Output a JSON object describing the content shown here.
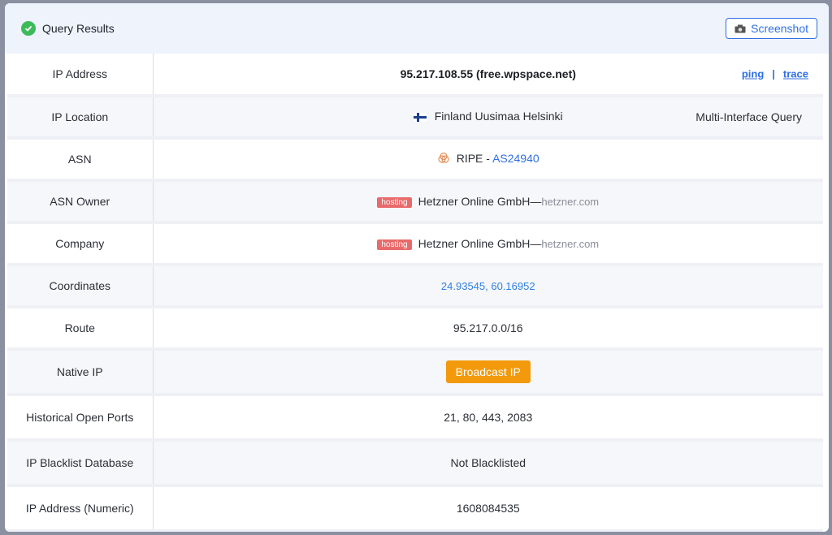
{
  "header": {
    "title": "Query Results",
    "screenshot_label": "Screenshot"
  },
  "rows": {
    "ip_address": {
      "label": "IP Address",
      "value": "95.217.108.55 (free.wpspace.net)",
      "ping": "ping",
      "separator": "|",
      "trace": "trace"
    },
    "ip_location": {
      "label": "IP Location",
      "value": "Finland Uusimaa Helsinki",
      "right": "Multi-Interface Query"
    },
    "asn": {
      "label": "ASN",
      "registry": "RIPE -",
      "asn_link": "AS24940"
    },
    "asn_owner": {
      "label": "ASN Owner",
      "badge": "hosting",
      "name": "Hetzner Online GmbH",
      "dash": "—",
      "domain": "hetzner.com"
    },
    "company": {
      "label": "Company",
      "badge": "hosting",
      "name": "Hetzner Online GmbH",
      "dash": "—",
      "domain": "hetzner.com"
    },
    "coordinates": {
      "label": "Coordinates",
      "value": "24.93545, 60.16952"
    },
    "route": {
      "label": "Route",
      "value": "95.217.0.0/16"
    },
    "native_ip": {
      "label": "Native IP",
      "button": "Broadcast IP"
    },
    "open_ports": {
      "label": "Historical Open Ports",
      "value": "21, 80, 443, 2083"
    },
    "blacklist": {
      "label": "IP Blacklist Database",
      "value": "Not Blacklisted"
    },
    "numeric": {
      "label": "IP Address (Numeric)",
      "value": "1608084535"
    }
  },
  "colors": {
    "accent": "#2f6fe4",
    "success": "#3dbb5a",
    "badge": "#e86a6a",
    "broadcast": "#f29a0c"
  }
}
